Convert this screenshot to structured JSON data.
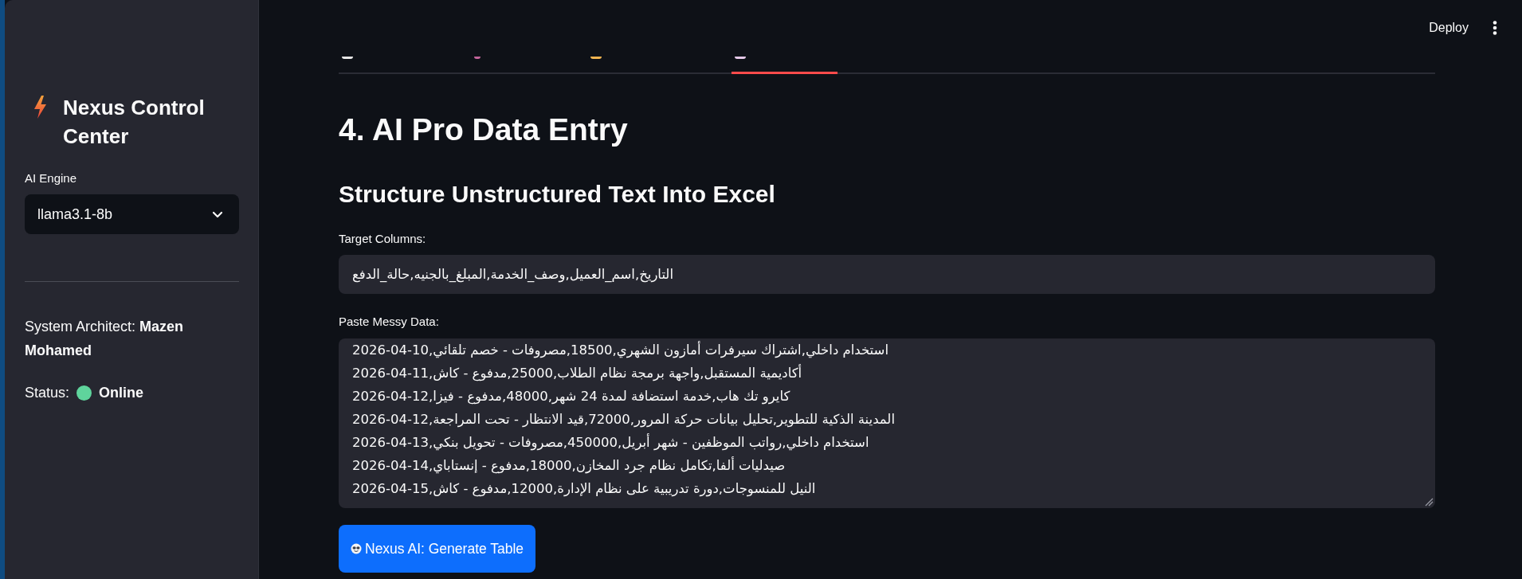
{
  "sidebar": {
    "title": "Nexus Control Center",
    "engine_select": {
      "label": "AI Engine",
      "value": "llama3.1-8b"
    },
    "architect": "System Architect: **Mazen Mohamed**",
    "status": {
      "label": "Status:",
      "value": "Online",
      "online": true
    }
  },
  "header": {
    "deploy": "Deploy"
  },
  "tabs": [
    {
      "selected": false
    },
    {
      "selected": false
    },
    {
      "selected": false
    },
    {
      "selected": true
    }
  ],
  "page": {
    "title": "4. AI Pro Data Entry",
    "subtitle": "Structure Unstructured Text Into Excel",
    "target_columns": {
      "label": "Target Columns:",
      "value": "التاريخ,اسم_العميل,وصف_الخدمة,المبلغ_بالجنيه,حالة_الدفع"
    },
    "messy_data": {
      "label": "Paste Messy Data:",
      "lines": [
        "2026-04-10,استخدام داخلي,اشتراك سيرفرات أمازون الشهري,18500,مصروفات - خصم تلقائي",
        "2026-04-11,أكاديمية المستقبل,واجهة برمجة نظام الطلاب,25000,مدفوع - كاش",
        "2026-04-12,كايرو تك هاب,خدمة استضافة لمدة 24 شهر,48000,مدفوع - فيزا",
        "2026-04-12,المدينة الذكية للتطوير,تحليل بيانات حركة المرور,72000,قيد الانتظار - تحت المراجعة",
        "2026-04-13,استخدام داخلي,رواتب الموظفين - شهر أبريل,450000,مصروفات - تحويل بنكي",
        "2026-04-14,صيدليات ألفا,تكامل نظام جرد المخازن,18000,مدفوع - إنستاباي",
        "2026-04-15,النيل للمنسوجات,دورة تدريبية على نظام الإدارة,12000,مدفوع - كاش"
      ]
    },
    "generate_button": "Nexus AI: Generate Table"
  }
}
